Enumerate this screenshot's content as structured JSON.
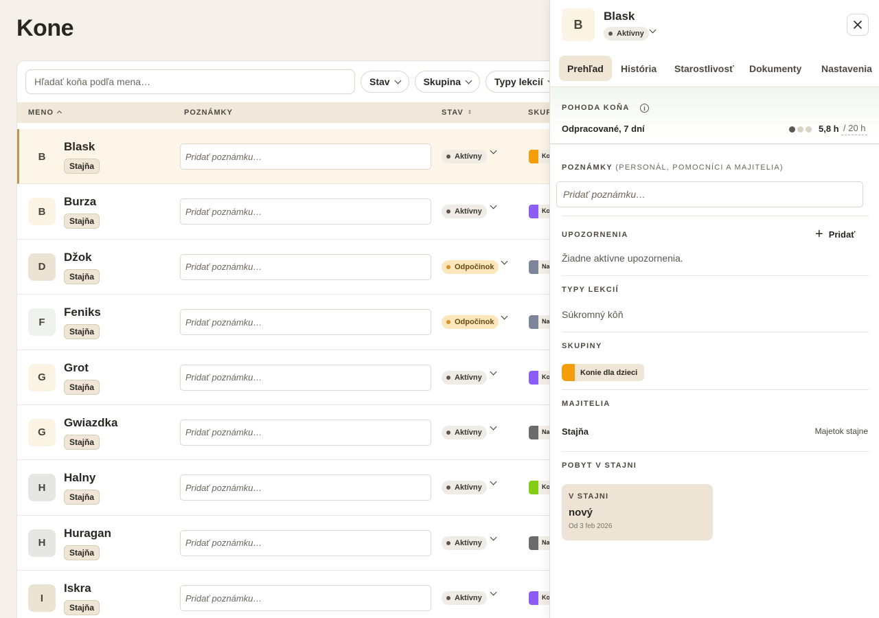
{
  "page": {
    "title": "Kone"
  },
  "toolbar": {
    "search_placeholder": "Hľadať koňa podľa mena…",
    "filters": [
      "Stav",
      "Skupina",
      "Typy lekcií"
    ]
  },
  "table": {
    "columns": {
      "name": "MENO",
      "notes": "POZNÁMKY",
      "status": "STAV",
      "groups": "SKUP"
    },
    "note_placeholder": "Pridať poznámku…",
    "rows": [
      {
        "initial": "B",
        "name": "Blask",
        "tag": "Stajňa",
        "status": "Aktívny",
        "status_kind": "active",
        "group_label": "Ko",
        "group_color": "#f59e0b",
        "avatar_color": "#fdf6e8",
        "selected": true
      },
      {
        "initial": "B",
        "name": "Burza",
        "tag": "Stajňa",
        "status": "Aktívny",
        "status_kind": "active",
        "group_label": "Ko",
        "group_color": "#8b5cf6",
        "avatar_color": "#fbf4e4"
      },
      {
        "initial": "D",
        "name": "Džok",
        "tag": "Stajňa",
        "status": "Odpočinok",
        "status_kind": "rest",
        "group_label": "Na",
        "group_color": "#7c8599",
        "avatar_color": "#ebe3d4"
      },
      {
        "initial": "F",
        "name": "Feniks",
        "tag": "Stajňa",
        "status": "Odpočinok",
        "status_kind": "rest",
        "group_label": "Na",
        "group_color": "#7c8599",
        "avatar_color": "#eef1ec"
      },
      {
        "initial": "G",
        "name": "Grot",
        "tag": "Stajňa",
        "status": "Aktívny",
        "status_kind": "active",
        "group_label": "Ko",
        "group_color": "#8b5cf6",
        "avatar_color": "#fbf4e4"
      },
      {
        "initial": "G",
        "name": "Gwiazdka",
        "tag": "Stajňa",
        "status": "Aktívny",
        "status_kind": "active",
        "group_label": "Na",
        "group_color": "#6b6b6b",
        "avatar_color": "#fbf4e4"
      },
      {
        "initial": "H",
        "name": "Halny",
        "tag": "Stajňa",
        "status": "Aktívny",
        "status_kind": "active",
        "group_label": "Ko",
        "group_color": "#84cc16",
        "avatar_color": "#e6e6e4"
      },
      {
        "initial": "H",
        "name": "Huragan",
        "tag": "Stajňa",
        "status": "Aktívny",
        "status_kind": "active",
        "group_label": "Na",
        "group_color": "#6b6b6b",
        "avatar_color": "#e6e6e4"
      },
      {
        "initial": "I",
        "name": "Iskra",
        "tag": "Stajňa",
        "status": "Aktívny",
        "status_kind": "active",
        "group_label": "Ko",
        "group_color": "#8b5cf6",
        "avatar_color": "#ebe3d4"
      }
    ]
  },
  "panel": {
    "initial": "B",
    "name": "Blask",
    "status": "Aktívny",
    "close_icon": "close-icon",
    "tabs": [
      "Prehľad",
      "História",
      "Starostlivosť",
      "Dokumenty",
      "Nastavenia"
    ],
    "active_tab": "Prehľad",
    "wellness": {
      "heading": "POHODA KOŇA",
      "worked_label": "Odpracované, 7 dní",
      "hours": "5,8 h",
      "max": "/ 20 h",
      "dots": [
        "#5b574f",
        "#d9d3c6",
        "#d9d3c6"
      ]
    },
    "notes": {
      "heading": "POZNÁMKY",
      "subheading": "(PERSONÁL, POMOCNÍCI A MAJITELIA)",
      "placeholder": "Pridať poznámku…"
    },
    "alerts": {
      "heading": "UPOZORNENIA",
      "add_label": "Pridať",
      "empty": "Žiadne aktívne upozornenia."
    },
    "lesson_types": {
      "heading": "TYPY LEKCIÍ",
      "value": "Súkromný kôň"
    },
    "groups": {
      "heading": "SKUPINY",
      "chip": "Konie dla dzieci",
      "chip_color": "#f59e0b"
    },
    "owners": {
      "heading": "MAJITELIA",
      "name": "Stajňa",
      "type": "Majetok stajne"
    },
    "stay": {
      "heading": "POBYT V STAJNI",
      "card_label": "V STAJNI",
      "card_value": "nový",
      "card_since": "Od 3 feb 2026"
    }
  }
}
